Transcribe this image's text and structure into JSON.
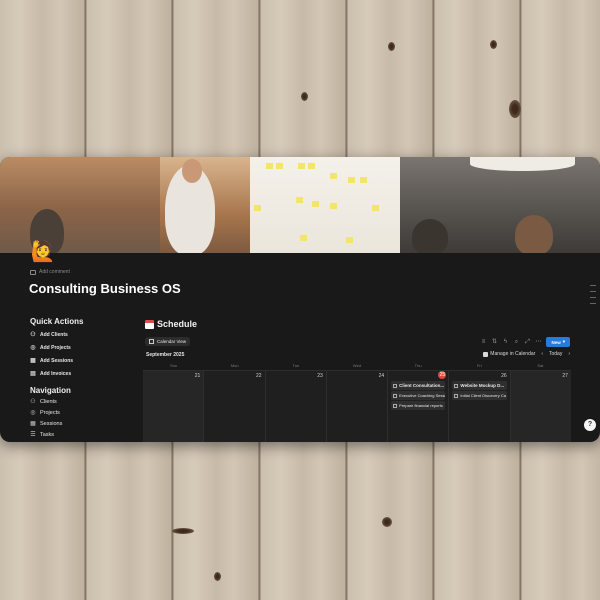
{
  "page": {
    "add_comment": "Add comment",
    "title": "Consulting Business OS",
    "icon": "person-raising-hand-emoji"
  },
  "quick_actions": {
    "title": "Quick Actions",
    "items": [
      {
        "label": "Add Clients",
        "icon": "people-icon"
      },
      {
        "label": "Add Projects",
        "icon": "target-icon"
      },
      {
        "label": "Add Sessions",
        "icon": "calendar-icon"
      },
      {
        "label": "Add Invoices",
        "icon": "invoice-icon"
      }
    ]
  },
  "navigation": {
    "title": "Navigation",
    "items": [
      {
        "label": "Clients",
        "icon": "people-icon"
      },
      {
        "label": "Projects",
        "icon": "target-icon"
      },
      {
        "label": "Sessions",
        "icon": "calendar-icon"
      },
      {
        "label": "Tasks",
        "icon": "checklist-icon"
      }
    ]
  },
  "schedule": {
    "title": "Schedule",
    "view_tab": "Calendar View",
    "new_button": "New",
    "month": "September 2025",
    "manage": "Manage in Calendar",
    "today": "Today",
    "weekdays": [
      "Sun",
      "Mon",
      "Tue",
      "Wed",
      "Thu",
      "Fri",
      "Sat"
    ],
    "days": [
      {
        "num": "21",
        "events": []
      },
      {
        "num": "22",
        "events": []
      },
      {
        "num": "23",
        "events": []
      },
      {
        "num": "24",
        "events": []
      },
      {
        "num": "25",
        "today": true,
        "events": [
          "Client Consultation...",
          "Executive Coaching Sessi",
          "Prepare financial reports"
        ]
      },
      {
        "num": "26",
        "events": [
          "Website Mockup D...",
          "Initial Client Discovery Ca"
        ]
      },
      {
        "num": "27",
        "events": []
      }
    ]
  },
  "colors": {
    "background": "#191919",
    "accent": "#2a7ad8",
    "today": "#e0483e"
  }
}
